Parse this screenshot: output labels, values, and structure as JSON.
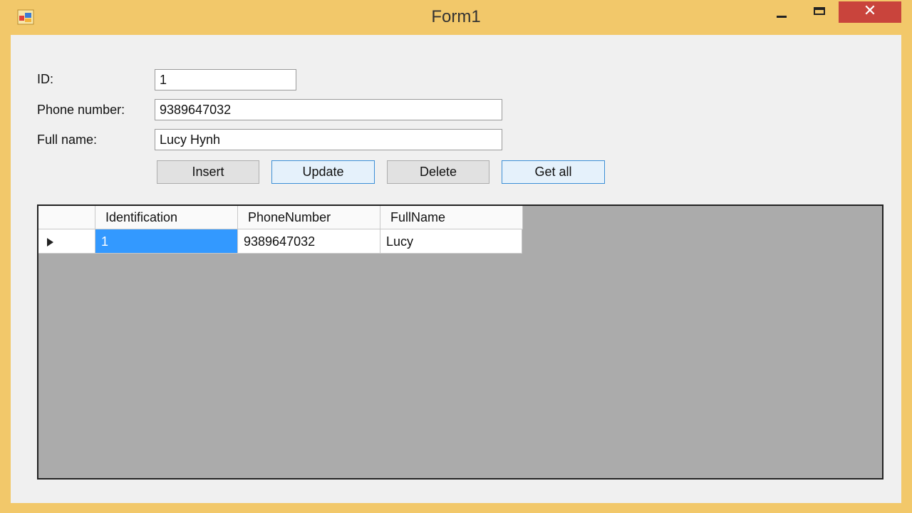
{
  "window": {
    "title": "Form1",
    "controls": {
      "minimize_icon": "minimize-icon",
      "maximize_icon": "maximize-icon",
      "close_icon": "close-icon",
      "close_glyph": "✕"
    },
    "colors": {
      "frame": "#f2c86a",
      "close": "#c9443c",
      "selection": "#3399ff"
    }
  },
  "form": {
    "id_label": "ID:",
    "id_value": "1",
    "phone_label": "Phone number:",
    "phone_value": "9389647032",
    "name_label": "Full name:",
    "name_value": "Lucy Hynh"
  },
  "buttons": {
    "insert": "Insert",
    "update": "Update",
    "delete": "Delete",
    "get_all": "Get all"
  },
  "grid": {
    "columns": [
      "Identification",
      "PhoneNumber",
      "FullName"
    ],
    "rows": [
      {
        "Identification": "1",
        "PhoneNumber": "9389647032",
        "FullName": "Lucy",
        "selected": true
      }
    ]
  }
}
